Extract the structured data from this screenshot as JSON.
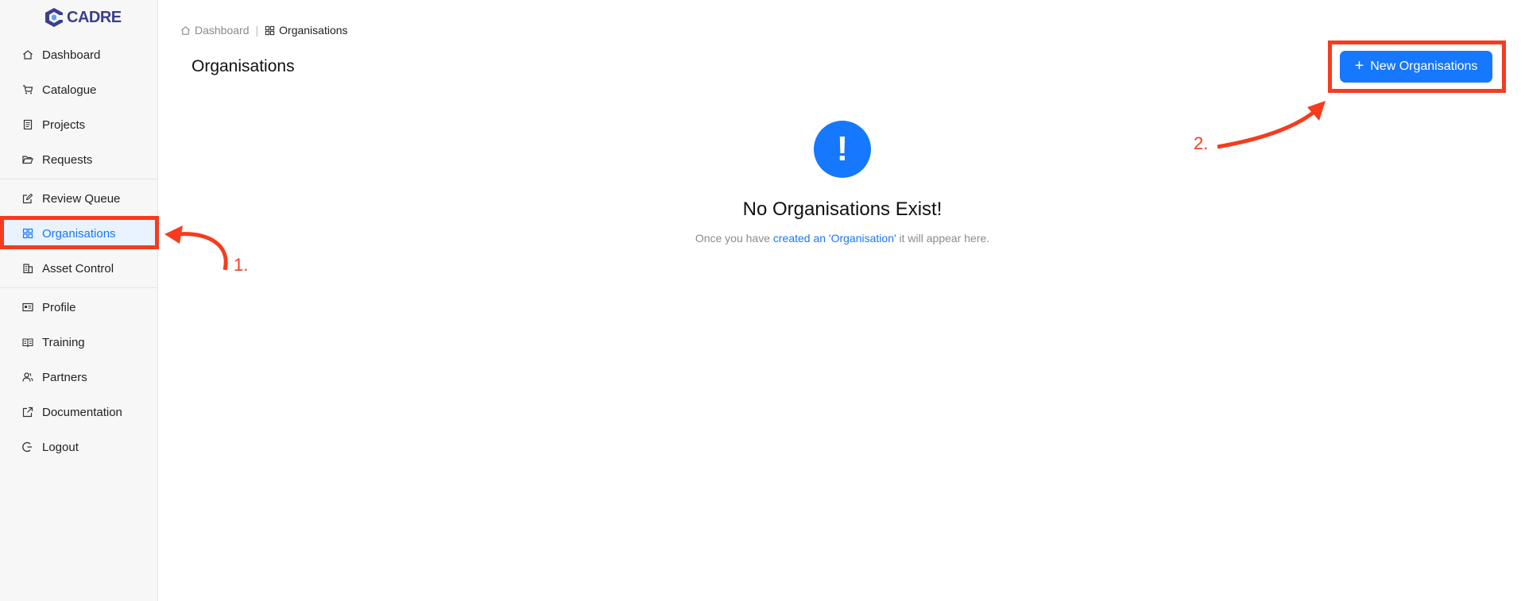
{
  "app": {
    "logo_text": "CADRE"
  },
  "sidebar": {
    "items": [
      {
        "label": "Dashboard",
        "icon": "home-icon"
      },
      {
        "label": "Catalogue",
        "icon": "cart-icon"
      },
      {
        "label": "Projects",
        "icon": "document-icon"
      },
      {
        "label": "Requests",
        "icon": "folder-open-icon"
      },
      {
        "label": "Review Queue",
        "icon": "edit-icon"
      },
      {
        "label": "Organisations",
        "icon": "grid-icon",
        "active": true
      },
      {
        "label": "Asset Control",
        "icon": "building-icon"
      },
      {
        "label": "Profile",
        "icon": "id-card-icon"
      },
      {
        "label": "Training",
        "icon": "book-icon"
      },
      {
        "label": "Partners",
        "icon": "users-icon"
      },
      {
        "label": "Documentation",
        "icon": "external-link-icon"
      },
      {
        "label": "Logout",
        "icon": "logout-icon"
      }
    ]
  },
  "breadcrumb": {
    "home": "Dashboard",
    "separator": "|",
    "current": "Organisations"
  },
  "page": {
    "title": "Organisations"
  },
  "actions": {
    "new_button": "New Organisations"
  },
  "empty_state": {
    "icon": "exclamation-icon",
    "title": "No Organisations Exist!",
    "desc_before": "Once you have ",
    "desc_link": "created an 'Organisation'",
    "desc_after": " it will appear here."
  },
  "annotations": {
    "step1": "1.",
    "step2": "2."
  },
  "colors": {
    "accent": "#1677ff",
    "annotation": "#f53c1e",
    "active_bg": "#e9f3ff"
  }
}
